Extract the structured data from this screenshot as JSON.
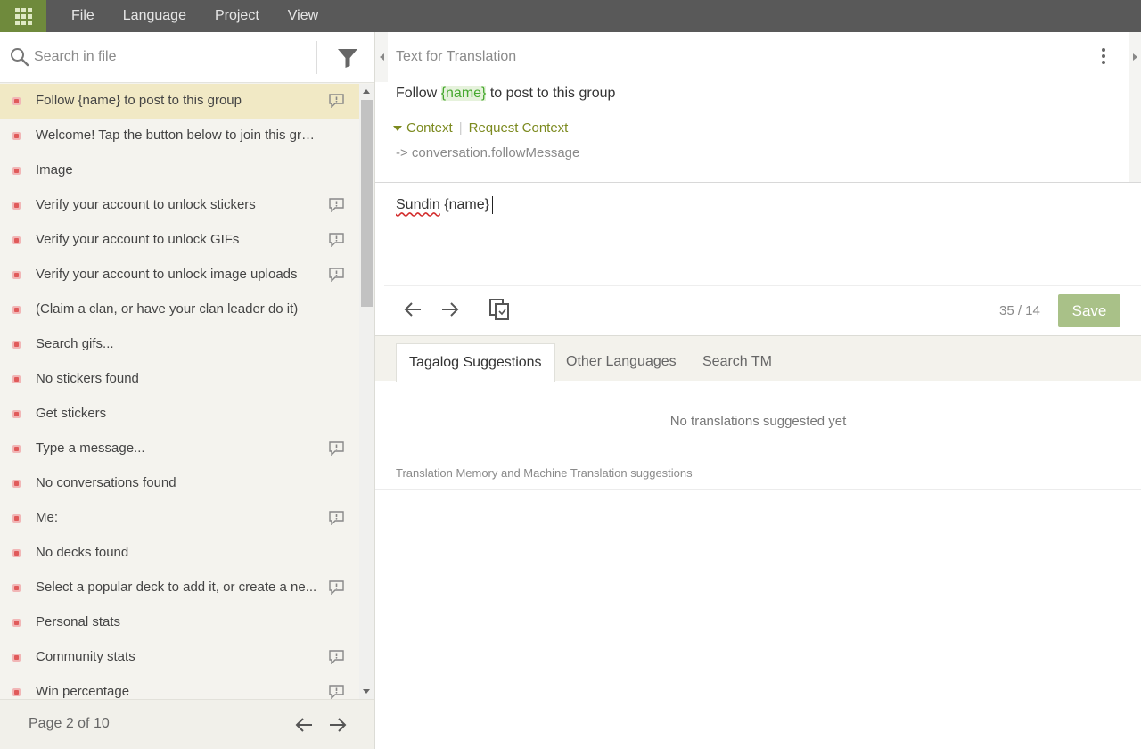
{
  "menu": [
    "File",
    "Language",
    "Project",
    "View"
  ],
  "search": {
    "placeholder": "Search in file",
    "value": ""
  },
  "entities": [
    {
      "text": "Follow {name} to post to this group",
      "comment": true,
      "selected": true
    },
    {
      "text": "Welcome! Tap the button below to join this group",
      "comment": false
    },
    {
      "text": "Image",
      "comment": false
    },
    {
      "text": "Verify your account to unlock stickers",
      "comment": true
    },
    {
      "text": "Verify your account to unlock GIFs",
      "comment": true
    },
    {
      "text": "Verify your account to unlock image uploads",
      "comment": true
    },
    {
      "text": "(Claim a clan, or have your clan leader do it)",
      "comment": false
    },
    {
      "text": "Search gifs...",
      "comment": false
    },
    {
      "text": "No stickers found",
      "comment": false
    },
    {
      "text": "Get stickers",
      "comment": false
    },
    {
      "text": "Type a message...",
      "comment": true
    },
    {
      "text": "No conversations found",
      "comment": false
    },
    {
      "text": "Me:",
      "comment": true
    },
    {
      "text": "No decks found",
      "comment": false
    },
    {
      "text": "Select a popular deck to add it, or create a ne...",
      "comment": true
    },
    {
      "text": "Personal stats",
      "comment": false
    },
    {
      "text": "Community stats",
      "comment": true
    },
    {
      "text": "Win percentage",
      "comment": true
    }
  ],
  "pager": {
    "label": "Page 2 of 10"
  },
  "source": {
    "section_title": "Text for Translation",
    "text_before": "Follow ",
    "placeholder": "{name}",
    "text_after": " to post to this group",
    "context_label": "Context",
    "request_context_label": "Request Context",
    "key_path": "-> conversation.followMessage"
  },
  "translation": {
    "word_misspelled": "Sundin",
    "word_rest": " {name}"
  },
  "editor": {
    "char_count": "35 / 14",
    "save_label": "Save"
  },
  "tabs": [
    "Tagalog Suggestions",
    "Other Languages",
    "Search TM"
  ],
  "suggestions": {
    "empty_message": "No translations suggested yet",
    "footer_note": "Translation Memory and Machine Translation suggestions"
  },
  "colors": {
    "topbar": "#595959",
    "apps_button": "#6f8a3c",
    "selected_row": "#f1e9c5",
    "placeholder_green": "#45a82e",
    "context_olive": "#7c8a1f",
    "save_button": "#a9c188",
    "status_dot": "#e05a5a"
  }
}
